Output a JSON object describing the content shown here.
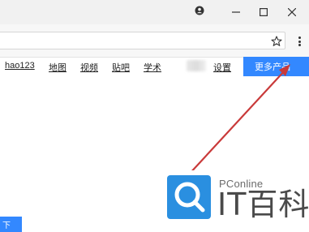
{
  "nav": {
    "links": [
      "hao123",
      "地图",
      "视频",
      "贴吧",
      "学术",
      "设置"
    ],
    "more_label": "更多产品"
  },
  "watermark": {
    "brand": "PConline",
    "title": "IT百科"
  },
  "corner_tab": {
    "label": "下"
  },
  "colors": {
    "accent": "#3388ff",
    "arrow": "#c93a3a"
  },
  "icons": [
    "profile-icon",
    "minimize-icon",
    "maximize-icon",
    "close-icon",
    "star-icon",
    "menu-icon",
    "search-icon"
  ]
}
